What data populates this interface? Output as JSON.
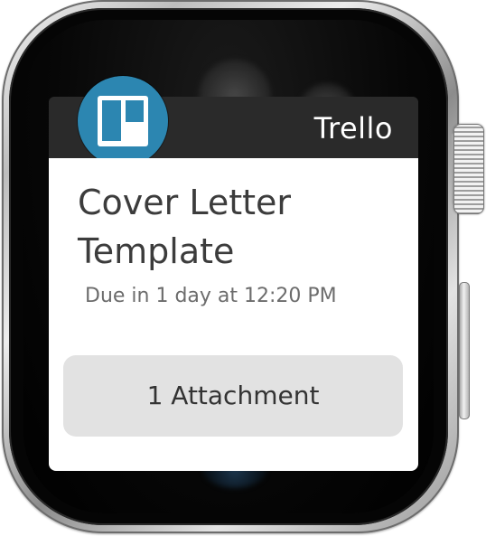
{
  "notification": {
    "app_name": "Trello",
    "app_icon": "trello-icon",
    "card_title": "Cover Letter Template",
    "due_text": "Due in 1 day at 12:20 PM",
    "action_button_label": "1 Attachment"
  },
  "colors": {
    "brand": "#2c86b1",
    "header_bar": "#2a2a2a",
    "button_bg": "#e2e2e2",
    "title_text": "#3c3c3c"
  }
}
